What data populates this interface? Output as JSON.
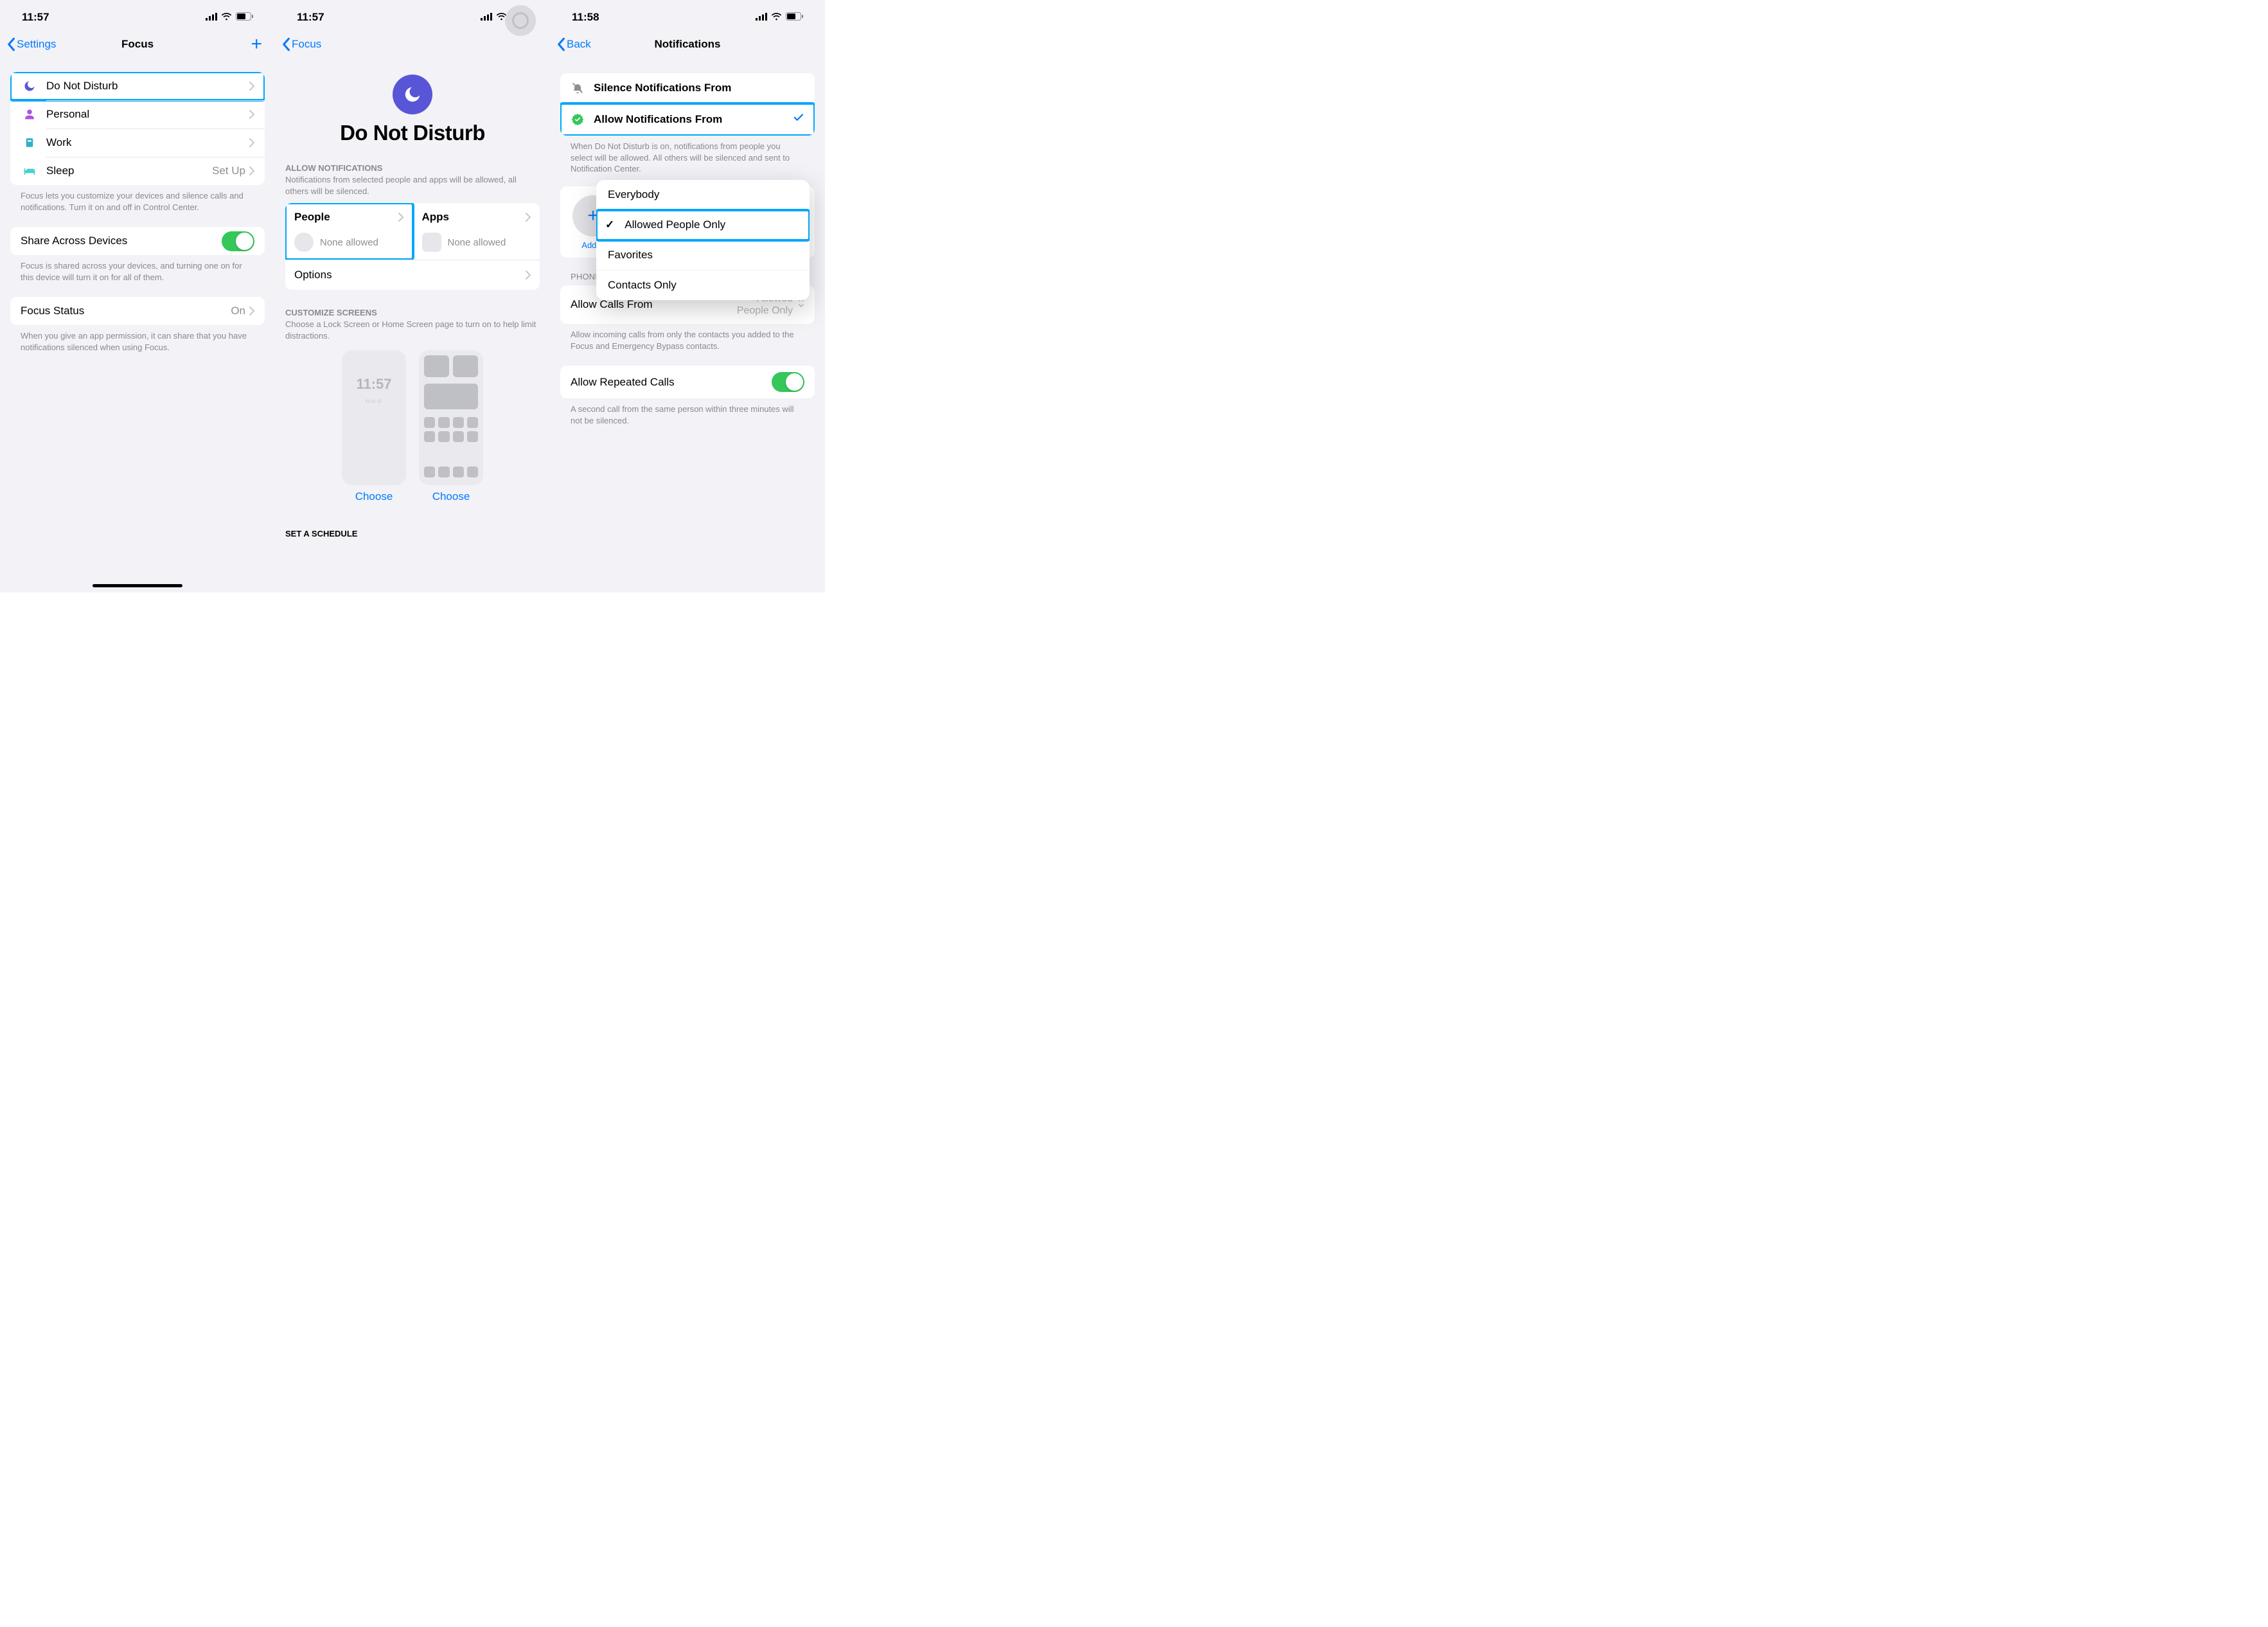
{
  "screen1": {
    "time": "11:57",
    "back": "Settings",
    "title": "Focus",
    "rows": {
      "dnd": "Do Not Disturb",
      "personal": "Personal",
      "work": "Work",
      "sleep": "Sleep",
      "sleep_detail": "Set Up"
    },
    "footer1": "Focus lets you customize your devices and silence calls and notifications. Turn it on and off in Control Center.",
    "share": "Share Across Devices",
    "footer2": "Focus is shared across your devices, and turning one on for this device will turn it on for all of them.",
    "status": "Focus Status",
    "status_detail": "On",
    "footer3": "When you give an app permission, it can share that you have notifications silenced when using Focus."
  },
  "screen2": {
    "time": "11:57",
    "back": "Focus",
    "big_title": "Do Not Disturb",
    "sec1_header": "ALLOW NOTIFICATIONS",
    "sec1_sub": "Notifications from selected people and apps will be allowed, all others will be silenced.",
    "people": "People",
    "apps": "Apps",
    "none": "None allowed",
    "options": "Options",
    "sec2_header": "CUSTOMIZE SCREENS",
    "sec2_sub": "Choose a Lock Screen or Home Screen page to turn on to help limit distractions.",
    "demo_time": "11:57",
    "choose": "Choose",
    "sec3_header": "SET A SCHEDULE"
  },
  "screen3": {
    "time": "11:58",
    "back": "Back",
    "title": "Notifications",
    "silence": "Silence Notifications From",
    "allow": "Allow Notifications From",
    "footer1": "When Do Not Disturb is on, notifications from people you select will be allowed. All others will be silenced and sent to Notification Center.",
    "addp": "Add P",
    "pop": {
      "a": "Everybody",
      "b": "Allowed People Only",
      "c": "Favorites",
      "d": "Contacts Only"
    },
    "phone_header": "PHONE",
    "allowcalls": "Allow Calls From",
    "allowcalls_val": "Allowed People Only",
    "footer2": "Allow incoming calls from only the contacts you added to the Focus and Emergency Bypass contacts.",
    "repeat": "Allow Repeated Calls",
    "footer3": "A second call from the same person within three minutes will not be silenced."
  }
}
